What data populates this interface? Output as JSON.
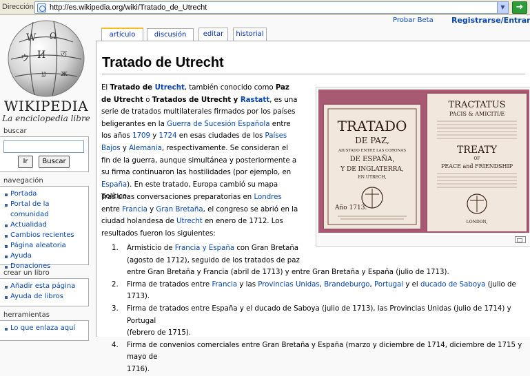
{
  "browser": {
    "address_label": "Dirección",
    "url": "http://es.wikipedia.org/wiki/Tratado_de_Utrecht"
  },
  "logo": {
    "title": "WIKIPEDIA",
    "tagline": "La enciclopedia libre"
  },
  "personal": {
    "probar_beta": "Probar Beta",
    "registrarse": "Registrarse/Entrar"
  },
  "tabs": [
    {
      "label": "artículo"
    },
    {
      "label": "discusión"
    },
    {
      "label": "editar"
    },
    {
      "label": "historial"
    }
  ],
  "search": {
    "heading": "buscar",
    "go_label": "Ir",
    "search_label": "Buscar"
  },
  "navigation": {
    "heading": "navegación",
    "items": [
      "Portada",
      "Portal de la comunidad",
      "Actualidad",
      "Cambios recientes",
      "Página aleatoria",
      "Ayuda",
      "Donaciones"
    ]
  },
  "crear": {
    "heading": "crear un libro",
    "items": [
      "Añadir esta página",
      "Ayuda de libros"
    ]
  },
  "tools": {
    "heading": "herramientas",
    "items": [
      "Lo que enlaza aquí"
    ]
  },
  "article": {
    "title": "Tratado de Utrecht",
    "p1": {
      "t1": "El ",
      "b1": "Tratado de ",
      "l1": "Utrecht",
      "t2": ", también conocido como ",
      "b2": "Paz de Utrecht",
      "t3": " o ",
      "b3": "Tratados de Utrecht y ",
      "l2": "Rastatt",
      "t4": ", es una serie de tratados multilaterales firmados por los países beligerantes en la ",
      "l3": "Guerra de Sucesión Española",
      "t5": " entre los años ",
      "l4": "1709",
      "t6": " y ",
      "l5": "1724",
      "t7": " en esas ciudades de los ",
      "l6": "Países Bajos",
      "t8": " y ",
      "l7": "Alemania",
      "t9": ", respectivamente. Se consideran el fin de la guerra, aunque simultánea y posteriormente a su firma continuaron las hostilidades (por ejemplo, en ",
      "l8": "España",
      "t10": "). En este tratado, Europa cambió su mapa político."
    },
    "p2": {
      "t1": "Tras unas conversaciones preparatorias en ",
      "l1": "Londres",
      "t2": " entre ",
      "l2": "Francia",
      "t3": " y ",
      "l3": "Gran Bretaña",
      "t4": ", el congreso se abrió en la ciudad holandesa de ",
      "l4": "Utrecht",
      "t5": " en enero de 1712. Los resultados fueron los siguientes:"
    },
    "list": [
      {
        "num": "1.",
        "t1": "Armisticio de ",
        "l1": "Francia y España",
        "t2": " con Gran Bretaña",
        "line2": "(agosto de 1712), seguido de los tratados de paz",
        "line3": "entre Gran Bretaña y Francia (abril de 1713) y entre Gran Bretaña y España (julio de 1713)."
      },
      {
        "num": "2.",
        "t1": "Firma de tratados entre ",
        "l1": "Francia",
        "t2": " y las ",
        "l2": "Provincias Unidas",
        "t3": ", ",
        "l3": "Brandeburgo",
        "t4": ", ",
        "l4": "Portugal",
        "t5": " y el ",
        "l5": "ducado de Saboya",
        "t6": " (julio de 1713)."
      },
      {
        "num": "3.",
        "text": "Firma de tratados entre España y el ducado de Saboya (julio de 1713), las Provincias Unidas (julio de 1714) y Portugal",
        "line2": "(febrero de 1715)."
      },
      {
        "num": "4.",
        "text": "Firma de convenios comerciales entre Gran Bretaña y España (marzo y diciembre de 1714, diciembre de 1715 y mayo de",
        "line2": "1716)."
      }
    ]
  },
  "image": {
    "left_book": {
      "line1": "TRATADO",
      "line2": "DE PAZ,",
      "line3": "AJUSTADO ENTRE LAS CORONAS",
      "line4": "DE ESPAÑA,",
      "line5": "Y DE INGLATERRA,",
      "line6": "EN UTRECH,",
      "year": "Año  1713."
    },
    "right_book": {
      "line1": "TRACTATUS",
      "line2": "PACIS & AMICITIÆ",
      "line3": "TREATY",
      "line4": "OF",
      "line5": "PEACE and FRIENDSHIP",
      "line6": "LONDON,"
    }
  }
}
